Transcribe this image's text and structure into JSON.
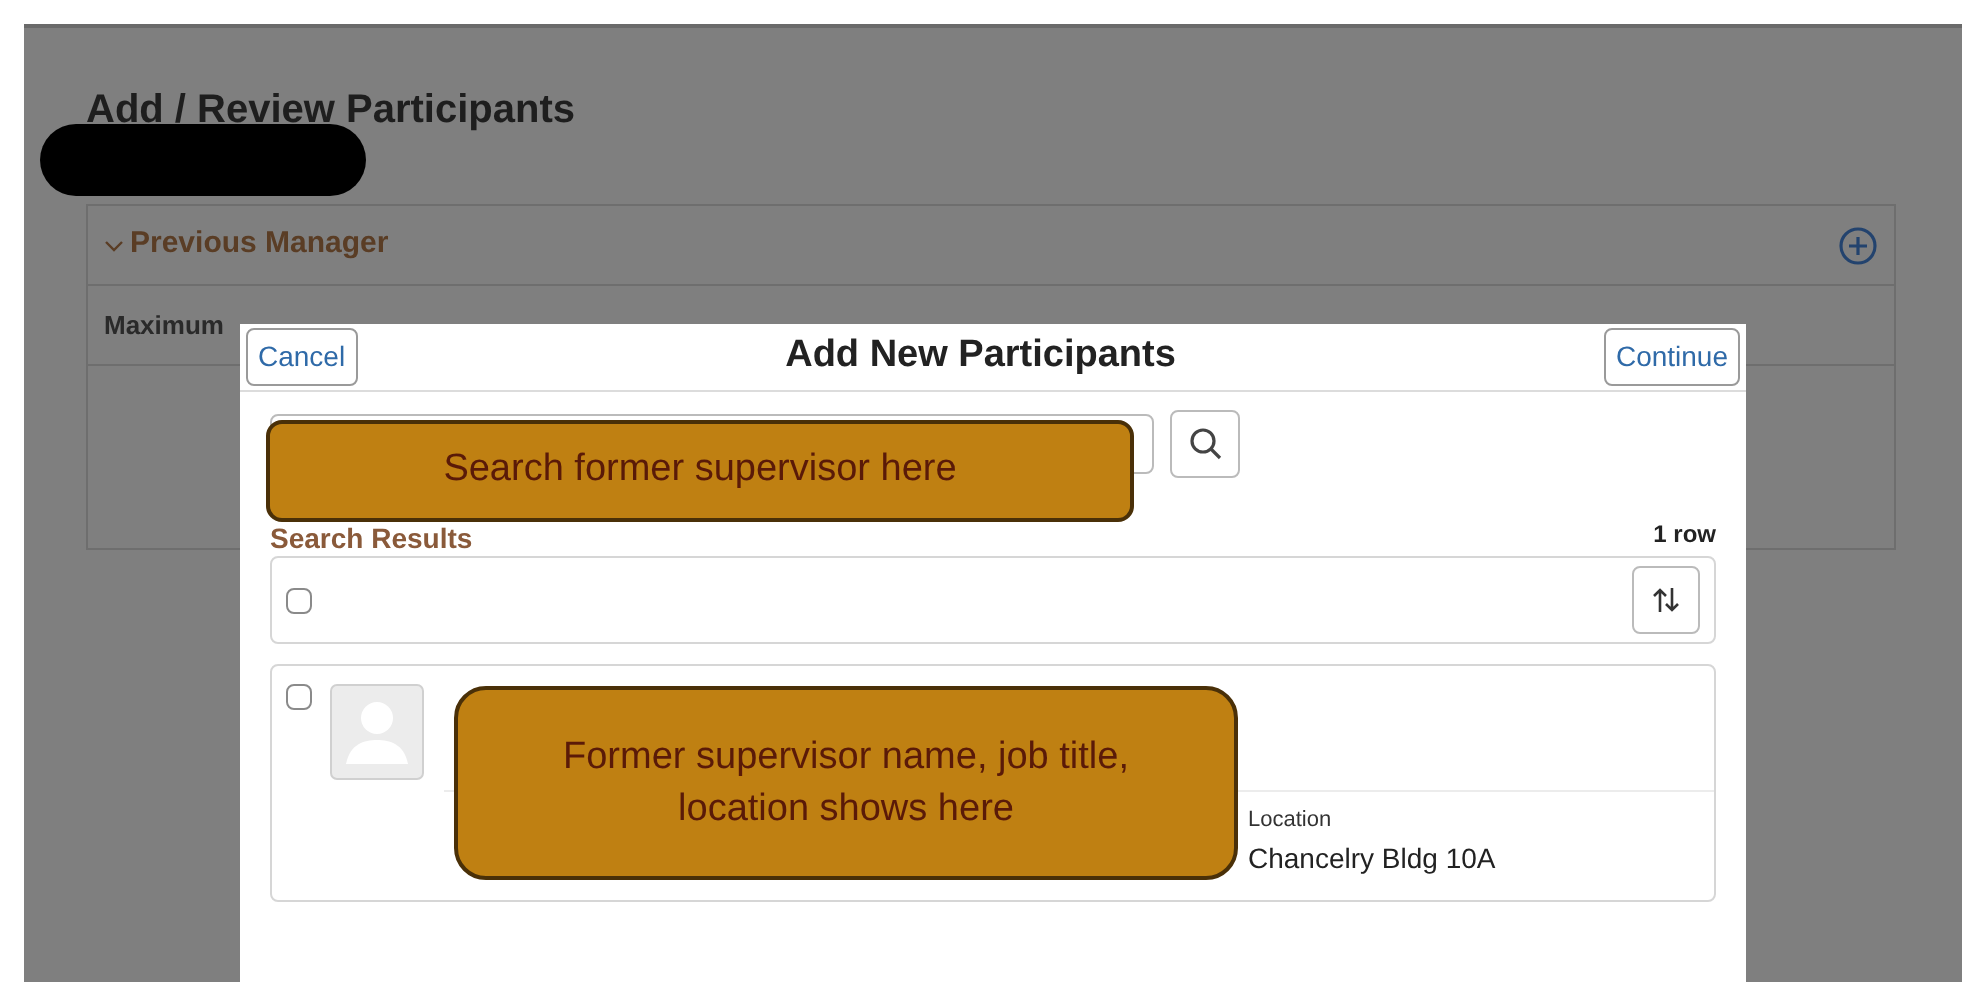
{
  "page": {
    "title": "Add / Review Participants"
  },
  "section": {
    "title": "Previous Manager",
    "expanded": true,
    "row_label": "Maximum"
  },
  "dialog": {
    "title": "Add New Participants",
    "cancel": "Cancel",
    "continue": "Continue",
    "results_label": "Search Results",
    "row_count": "1 row",
    "header_row": {
      "checked": false
    },
    "result": {
      "checked": false,
      "field_label": "Location",
      "field_value": "Chancelry Bldg 10A"
    }
  },
  "callouts": [
    "Search former supervisor here",
    "Former supervisor name, job title, location shows here"
  ]
}
